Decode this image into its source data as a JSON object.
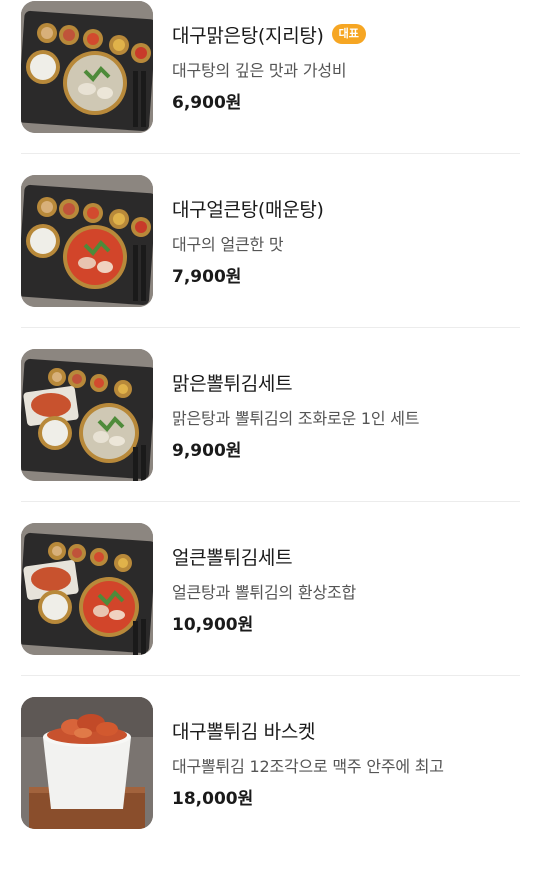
{
  "menu": {
    "items": [
      {
        "name": "대구맑은탕(지리탕)",
        "badge": "대표",
        "description": "대구탕의 깊은 맛과 가성비",
        "price": "6,900원",
        "image_icon": "clear-cod-soup-tray-photo"
      },
      {
        "name": "대구얼큰탕(매운탕)",
        "badge": "",
        "description": "대구의 얼큰한 맛",
        "price": "7,900원",
        "image_icon": "spicy-cod-soup-tray-photo"
      },
      {
        "name": "맑은뽈튀김세트",
        "badge": "",
        "description": "맑은탕과 뽈튀김의 조화로운 1인 세트",
        "price": "9,900원",
        "image_icon": "clear-soup-fried-set-photo"
      },
      {
        "name": "얼큰뽈튀김세트",
        "badge": "",
        "description": "얼큰탕과 뽈튀김의 환상조합",
        "price": "10,900원",
        "image_icon": "spicy-soup-fried-set-photo"
      },
      {
        "name": "대구뽈튀김 바스켓",
        "badge": "",
        "description": "대구뽈튀김 12조각으로 맥주 안주에 최고",
        "price": "18,000원",
        "image_icon": "fried-cod-basket-photo"
      }
    ]
  },
  "colors": {
    "badge": "#f6a623",
    "text_primary": "#1a1a1a",
    "text_secondary": "#555555",
    "divider": "#ececec"
  }
}
